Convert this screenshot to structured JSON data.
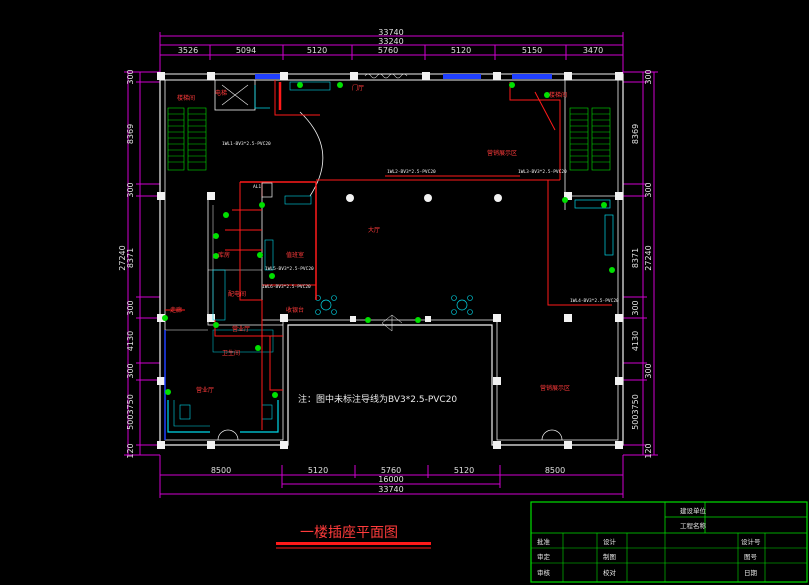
{
  "title": "一楼插座平面图",
  "note": "注：图中未标注导线为BV3*2.5-PVC20",
  "dimensions": {
    "top_total_outer": "33740",
    "top_total_inner": "33240",
    "top_segments": [
      "3526",
      "5094",
      "5120",
      "5760",
      "5120",
      "5150",
      "3470"
    ],
    "bottom_segments": [
      "8500",
      "5120",
      "5760",
      "5120",
      "8500"
    ],
    "bottom_mid": "16000",
    "bottom_total": "33740",
    "left_segments": [
      "300",
      "8369",
      "300",
      "8371",
      "300",
      "4130",
      "300",
      "5003750",
      "120"
    ],
    "left_total": "27240",
    "right_segments": [
      "300",
      "8369",
      "300",
      "8371",
      "300",
      "4130",
      "300",
      "5003750",
      "120"
    ],
    "right_total": "27240"
  },
  "rooms": {
    "elevator_hall": "电梯",
    "hall": "门厅",
    "stair_left": "楼梯间",
    "stair_right": "楼梯间",
    "corridor_left": "走廊",
    "store_1": "库房",
    "store_2": "配电间",
    "office_1": "值班室",
    "office_2": "收银台",
    "sales_left": "营业厅",
    "sales_right": "营业厅",
    "retail_right": "营销展示区",
    "retail_top": "营销展示区",
    "toilet": "卫生间",
    "lobby_label": "大厅"
  },
  "circuits": {
    "c1": "1WL1-BV3*2.5-PVC20",
    "c2": "1WL2-BV3*2.5-PVC20",
    "c3": "1WL3-BV3*2.5-PVC20",
    "c4": "1WL4-BV3*2.5-PVC20",
    "c5": "1WL5-BV3*2.5-PVC20",
    "c6": "1WL6-BV3*2.5-PVC20",
    "panel": "AL1"
  },
  "title_block": {
    "client_label": "建设单位",
    "project_label": "工程名称",
    "approve": "批准",
    "check": "审定",
    "review": "审核",
    "design": "设计",
    "draw": "制图",
    "proof": "校对",
    "design_no": "设计号",
    "drawing_no": "图号",
    "date": "日期"
  }
}
